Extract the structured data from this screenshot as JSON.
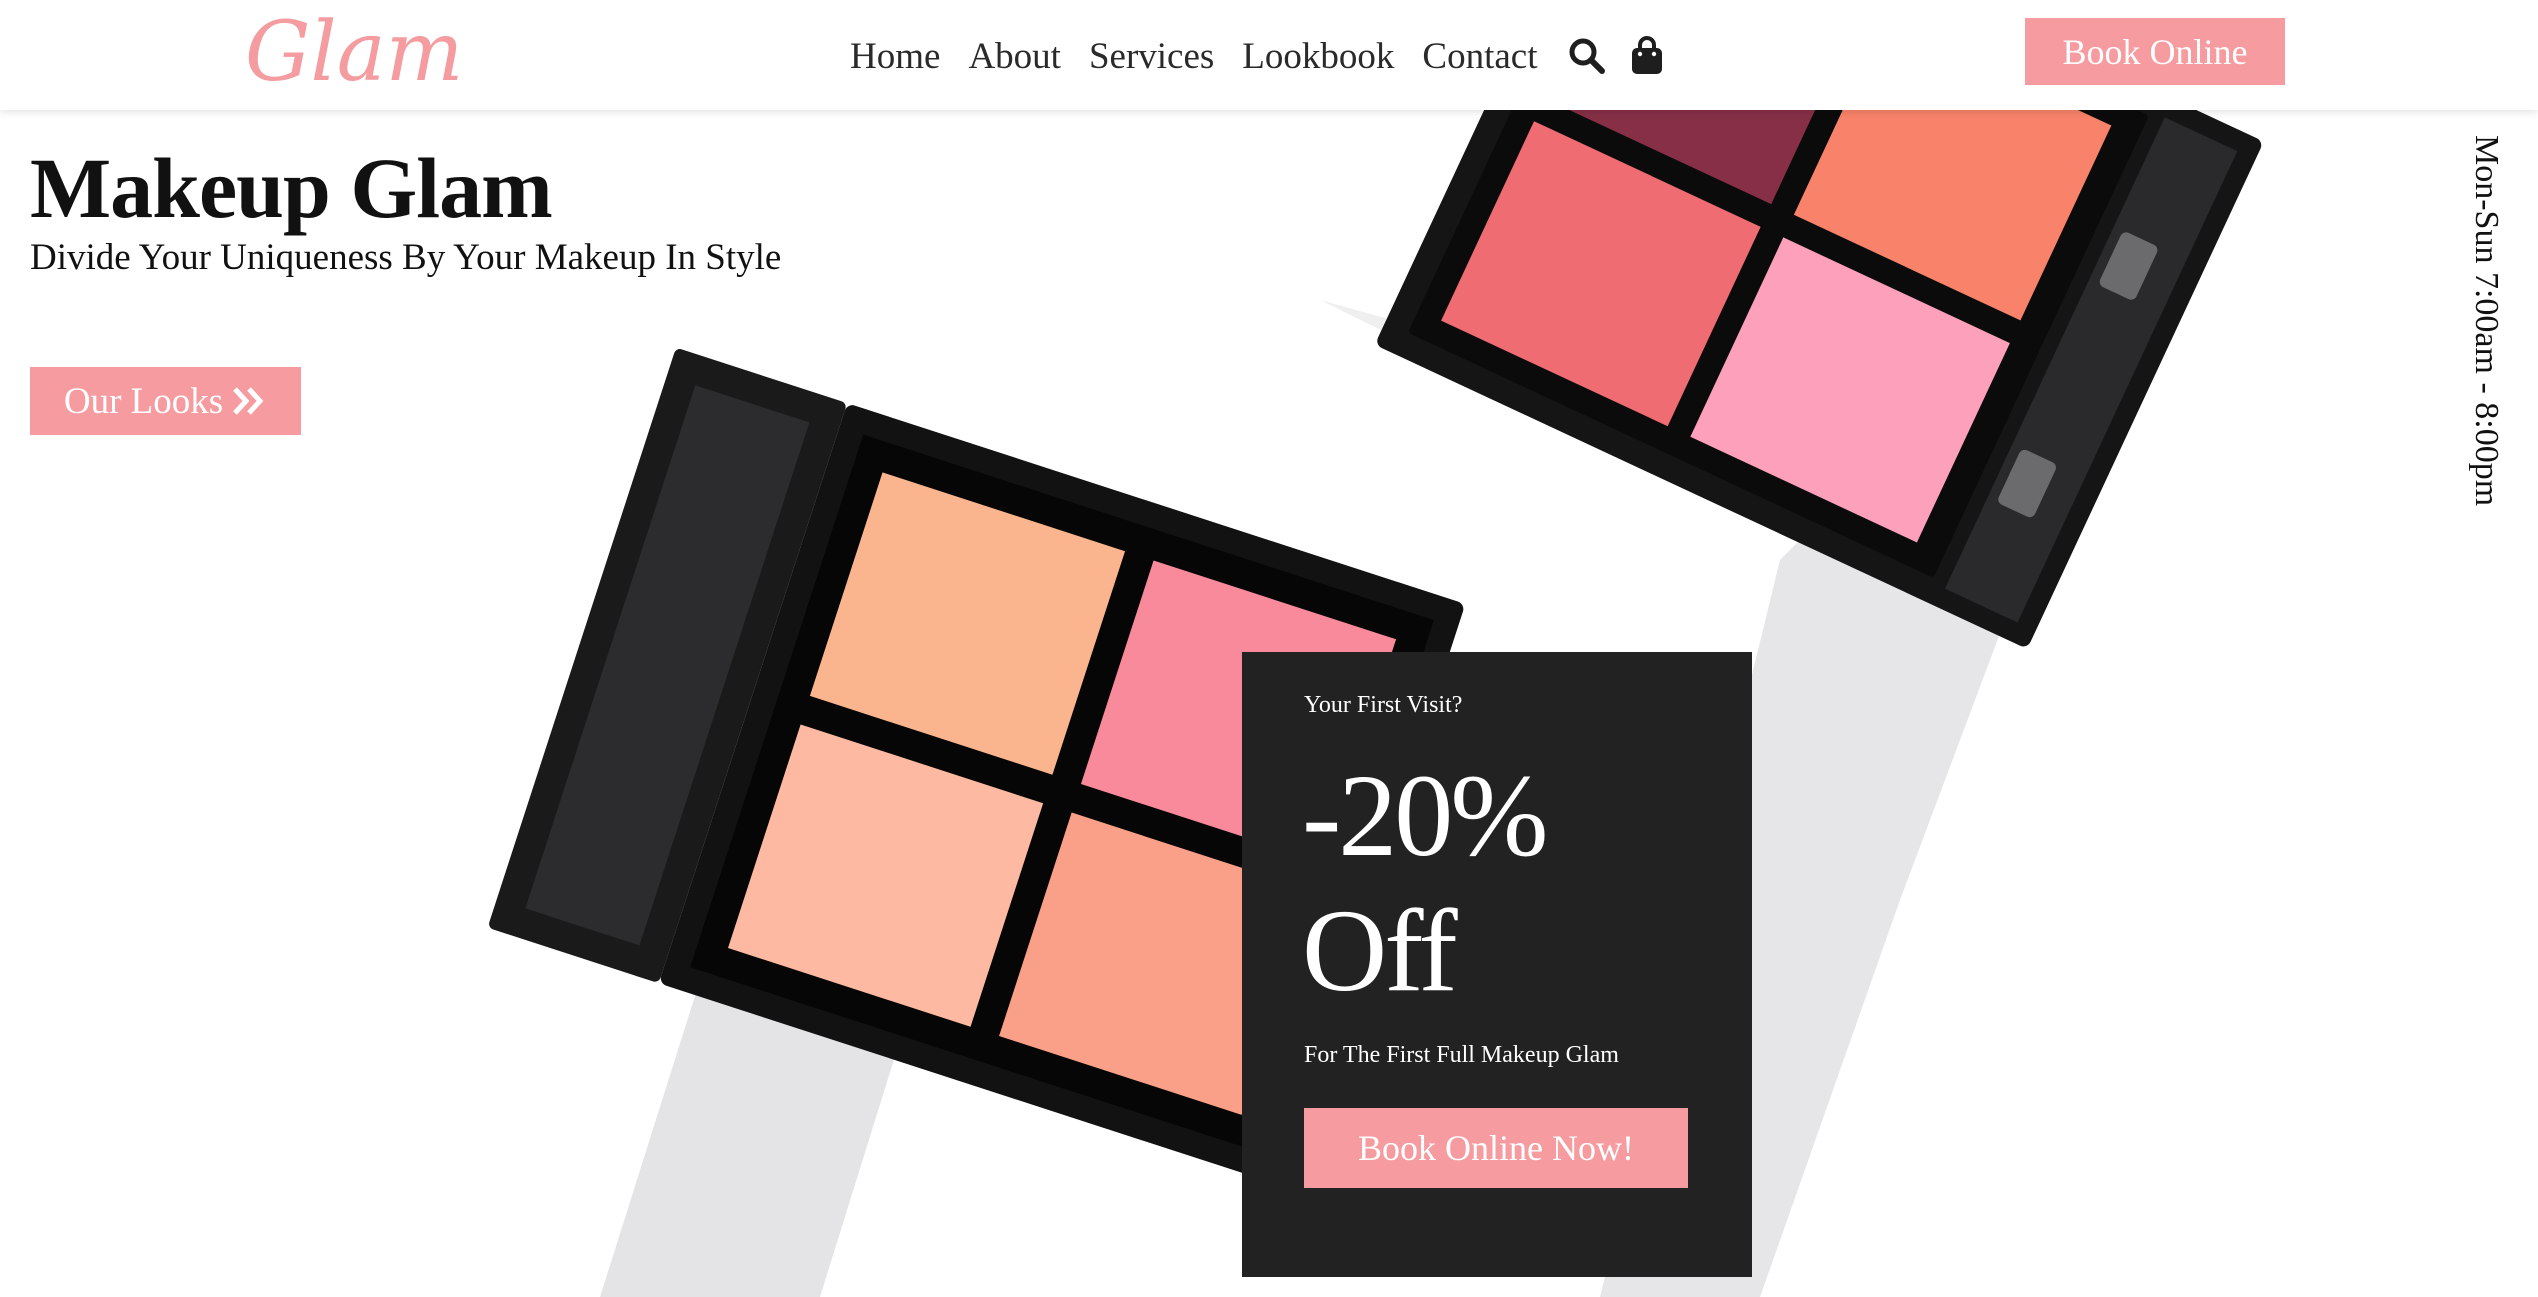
{
  "brand": {
    "logo_text": "Glam."
  },
  "header": {
    "nav": [
      {
        "label": "Home"
      },
      {
        "label": "About"
      },
      {
        "label": "Services"
      },
      {
        "label": "Lookbook"
      },
      {
        "label": "Contact"
      }
    ],
    "icons": [
      "search-icon",
      "shopping-bag-icon"
    ],
    "book_label": "Book Online"
  },
  "hero": {
    "title": "Makeup Glam",
    "subtitle": "Divide Your Uniqueness By Your Makeup In Style",
    "looks_label": "Our Looks",
    "hours": "Mon-Sun 7:00am - 8:00pm"
  },
  "promo": {
    "kicker": "Your First Visit?",
    "discount": "-20%",
    "discount_suffix": "Off",
    "note": "For The First Full Makeup Glam",
    "button_label": "Book Online Now!"
  },
  "colors": {
    "accent": "#f69ca0",
    "promo_bg": "#222222",
    "text": "#111111"
  }
}
